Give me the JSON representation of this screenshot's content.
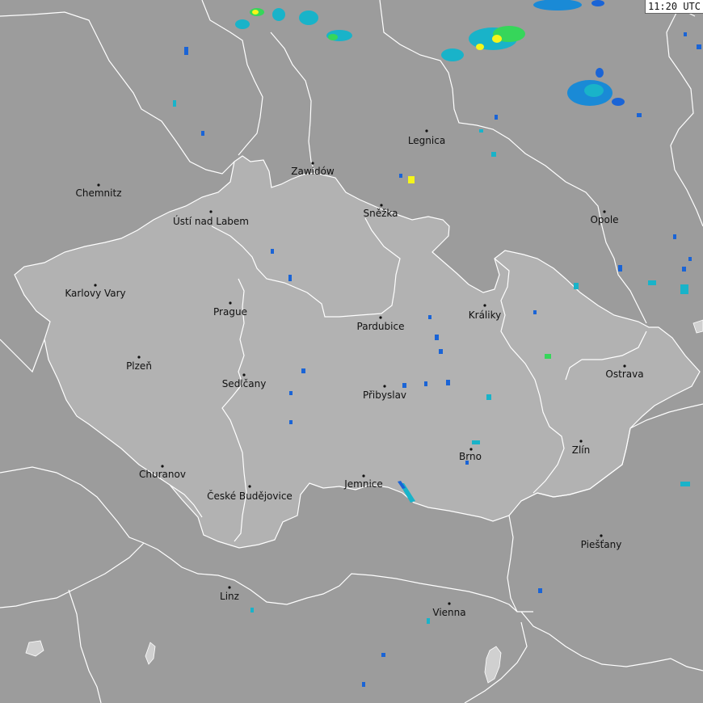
{
  "timestamp": "11:20 UTC",
  "colors": {
    "background": "#9c9c9c",
    "highlight_region": "#b2b2b2",
    "border_line": "#ffffff",
    "label_text": "#111111",
    "precip_light": "#1a64d6",
    "precip_medium": "#19b3c9",
    "precip_strong": "#36d65a",
    "precip_heavy": "#f5f51a"
  },
  "cities": [
    {
      "name": "Legnica"
    },
    {
      "name": "Zawidów"
    },
    {
      "name": "Chemnitz"
    },
    {
      "name": "Ústí nad Labem"
    },
    {
      "name": "Sněžka"
    },
    {
      "name": "Opole"
    },
    {
      "name": "Karlovy Vary"
    },
    {
      "name": "Prague"
    },
    {
      "name": "Králiky"
    },
    {
      "name": "Pardubice"
    },
    {
      "name": "Plzeň"
    },
    {
      "name": "Ostrava"
    },
    {
      "name": "Sedlčany"
    },
    {
      "name": "Přibyslav"
    },
    {
      "name": "Zlín"
    },
    {
      "name": "Brno"
    },
    {
      "name": "Churanov"
    },
    {
      "name": "Jemnice"
    },
    {
      "name": "České Budějovice"
    },
    {
      "name": "Piešťany"
    },
    {
      "name": "Linz"
    },
    {
      "name": "Vienna"
    }
  ]
}
